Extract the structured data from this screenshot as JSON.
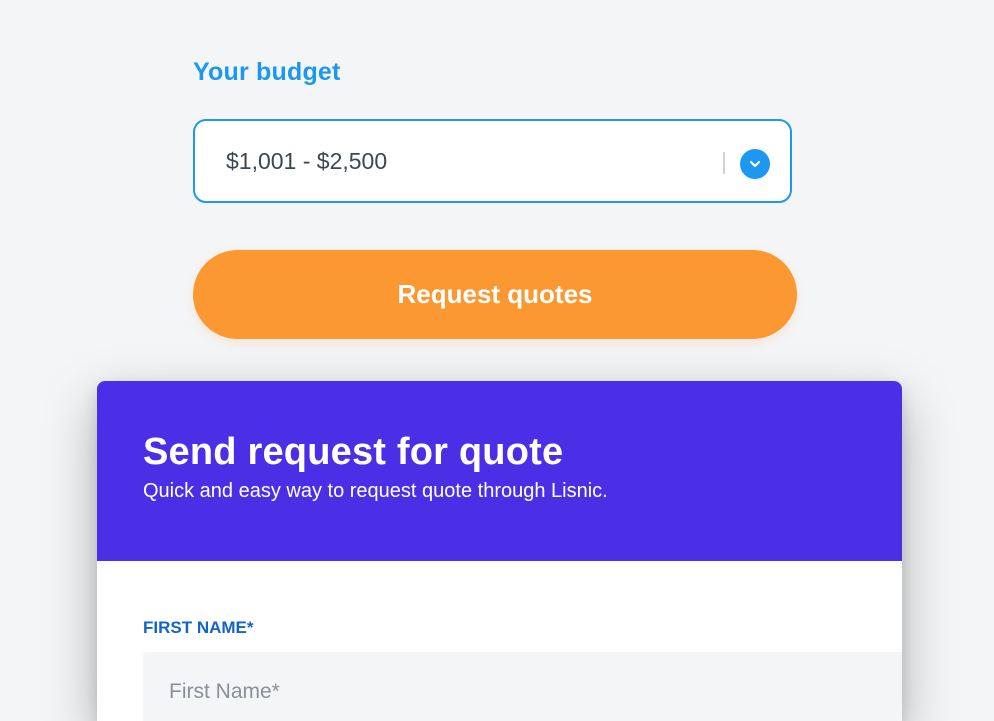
{
  "budget": {
    "label": "Your budget",
    "selected_value": "$1,001 - $2,500"
  },
  "actions": {
    "request_label": "Request quotes"
  },
  "quote_form": {
    "title": "Send request for quote",
    "subtitle": "Quick and easy way to request quote through Lisnic.",
    "first_name_label": "FIRST NAME*",
    "first_name_placeholder": "First Name*",
    "first_name_value": ""
  },
  "colors": {
    "accent_blue": "#1d98f0",
    "button_orange": "#fb9832",
    "header_purple": "#4a2fe6",
    "label_blue": "#1165c9"
  }
}
